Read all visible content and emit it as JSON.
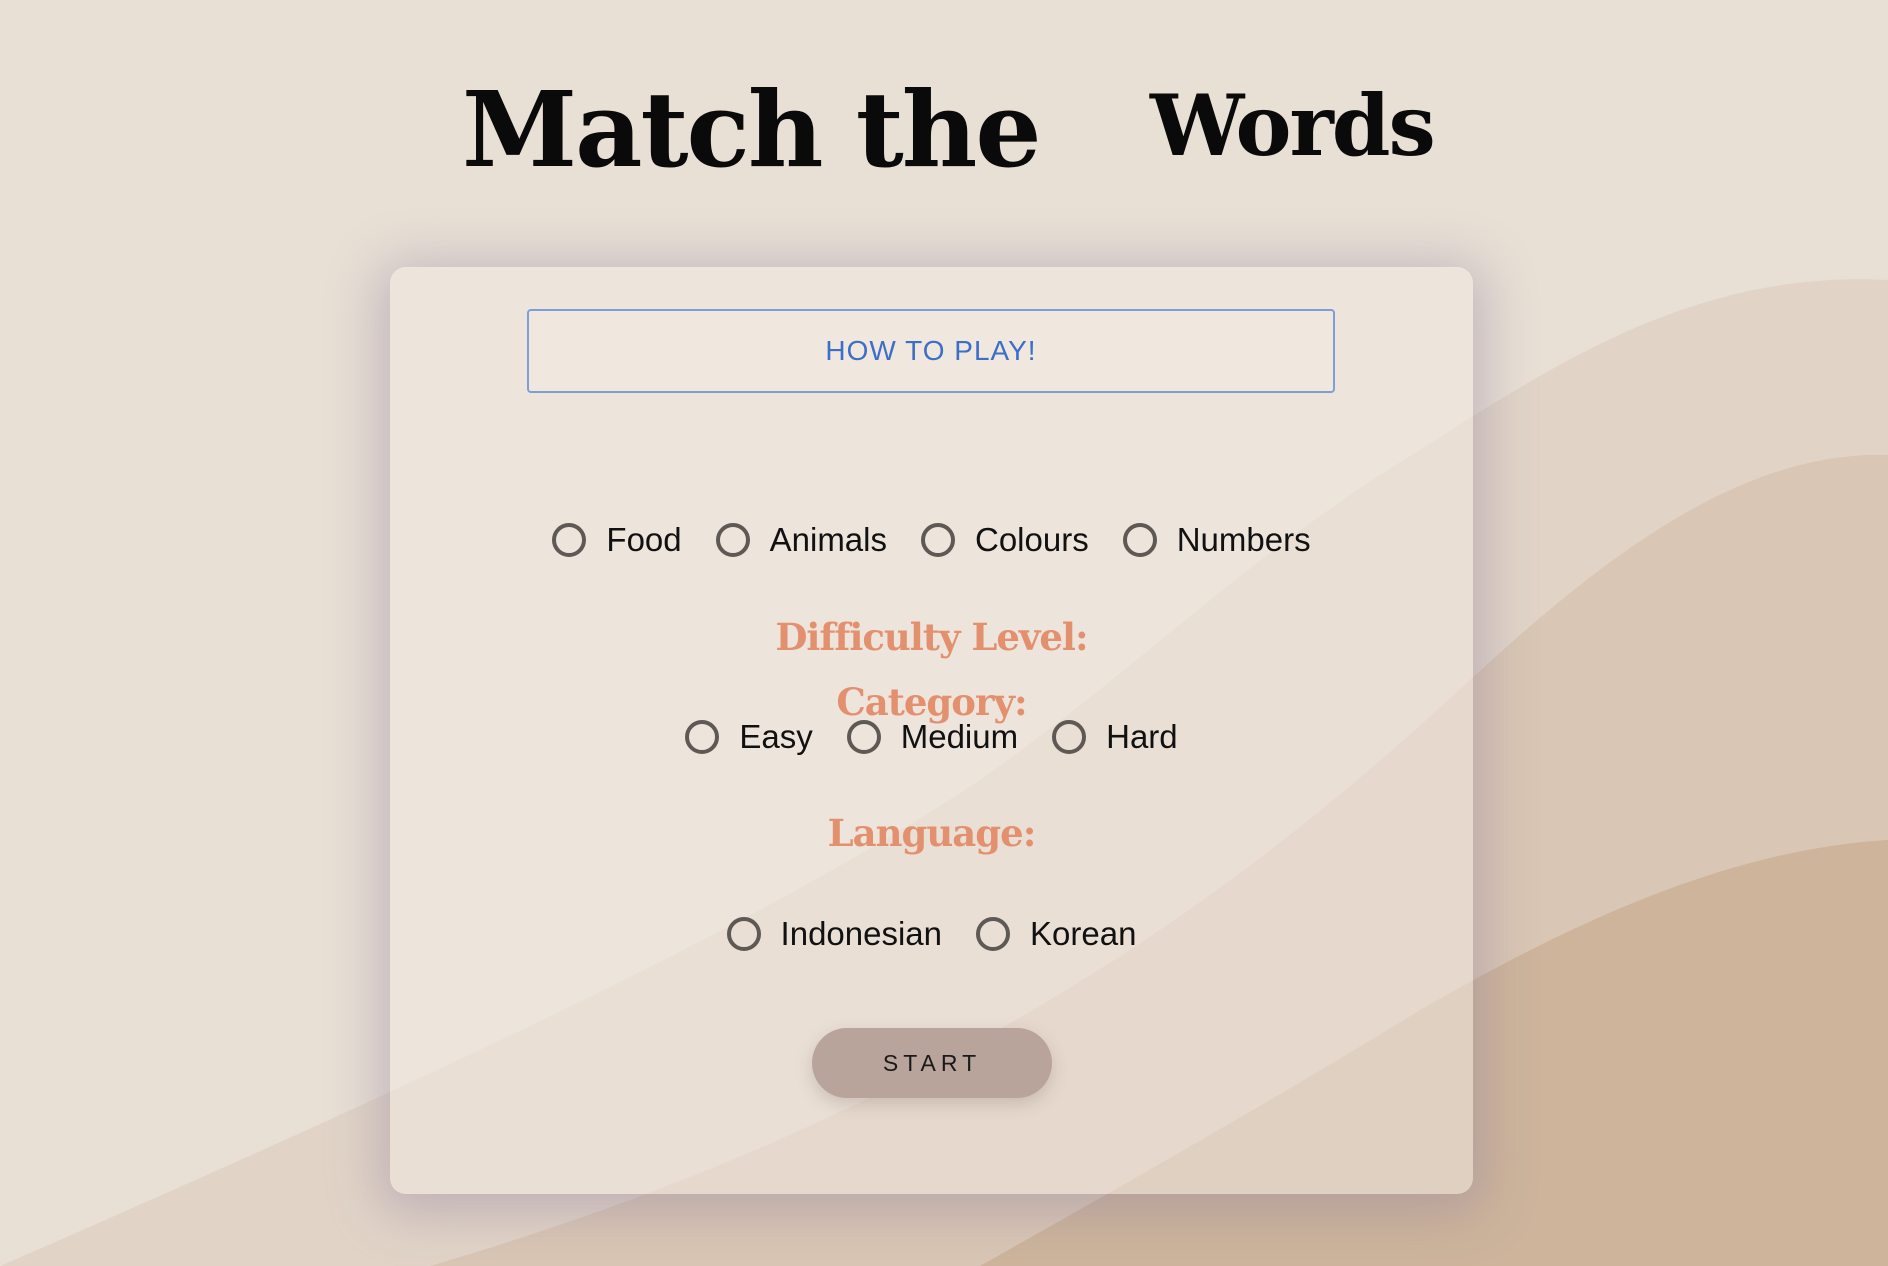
{
  "colors": {
    "background": "#e7ddd2",
    "title": "#0a0a0a",
    "section_heading": "#e3906f",
    "how_to_play_text": "#3b6fc8",
    "how_to_play_border": "#7d9fd6",
    "start_button": "#b9a49b",
    "radio_border": "#5f5955"
  },
  "title": {
    "part1": "Match the",
    "part2": "Words"
  },
  "how_to_play": {
    "label": "HOW TO PLAY!"
  },
  "category": {
    "heading": "Category:",
    "options": [
      "Food",
      "Animals",
      "Colours",
      "Numbers"
    ]
  },
  "difficulty": {
    "heading": "Difficulty Level:",
    "options": [
      "Easy",
      "Medium",
      "Hard"
    ]
  },
  "language": {
    "heading": "Language:",
    "options": [
      "Indonesian",
      "Korean"
    ]
  },
  "start": {
    "label": "START"
  }
}
